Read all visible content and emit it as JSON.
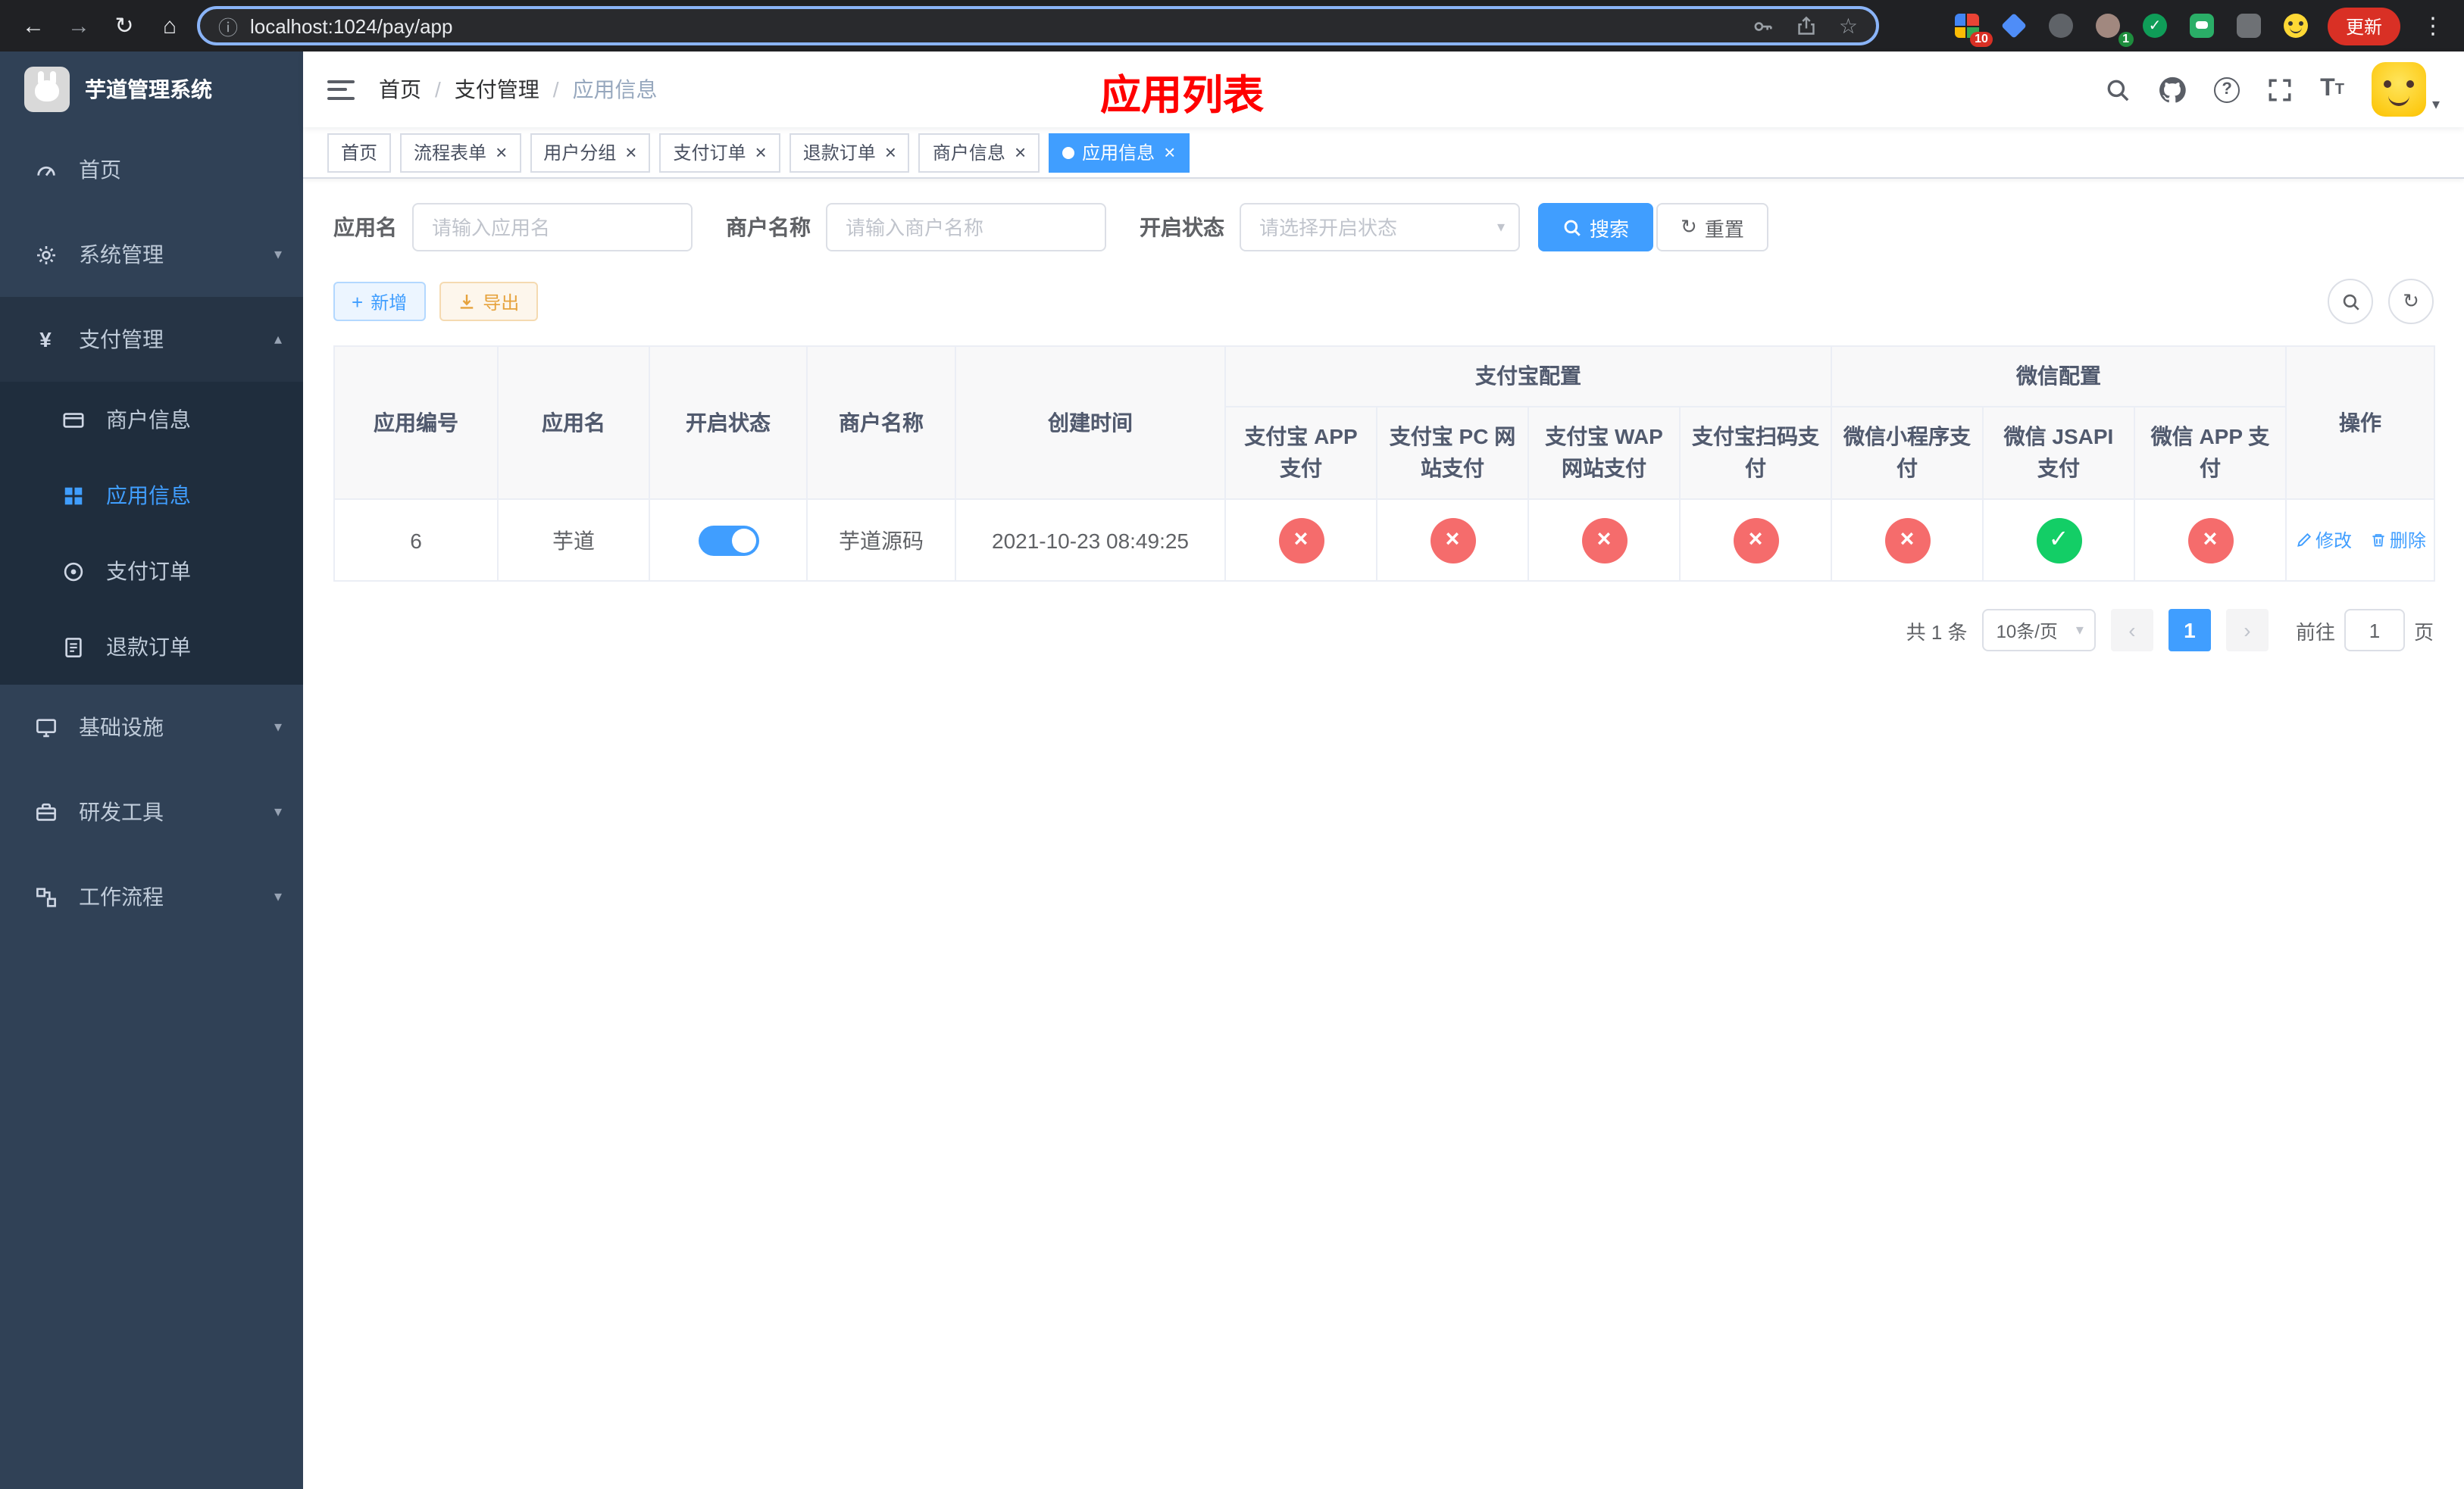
{
  "browser": {
    "url": "localhost:1024/pay/app",
    "update_button": "更新",
    "extensions_badge": "10",
    "profile_badge": "1"
  },
  "sidebar": {
    "app_title": "芋道管理系统",
    "menu": [
      {
        "label": "首页"
      },
      {
        "label": "系统管理"
      },
      {
        "label": "支付管理"
      },
      {
        "label": "商户信息"
      },
      {
        "label": "应用信息"
      },
      {
        "label": "支付订单"
      },
      {
        "label": "退款订单"
      },
      {
        "label": "基础设施"
      },
      {
        "label": "研发工具"
      },
      {
        "label": "工作流程"
      }
    ]
  },
  "navbar": {
    "breadcrumb": [
      "首页",
      "支付管理",
      "应用信息"
    ],
    "page_title": "应用列表"
  },
  "tags": [
    {
      "label": "首页",
      "closable": false,
      "active": false
    },
    {
      "label": "流程表单",
      "closable": true,
      "active": false
    },
    {
      "label": "用户分组",
      "closable": true,
      "active": false
    },
    {
      "label": "支付订单",
      "closable": true,
      "active": false
    },
    {
      "label": "退款订单",
      "closable": true,
      "active": false
    },
    {
      "label": "商户信息",
      "closable": true,
      "active": false
    },
    {
      "label": "应用信息",
      "closable": true,
      "active": true
    }
  ],
  "filters": {
    "app_name_label": "应用名",
    "app_name_placeholder": "请输入应用名",
    "merchant_label": "商户名称",
    "merchant_placeholder": "请输入商户名称",
    "status_label": "开启状态",
    "status_placeholder": "请选择开启状态",
    "search_button": "搜索",
    "reset_button": "重置"
  },
  "toolbar": {
    "add_button": "新增",
    "export_button": "导出"
  },
  "table": {
    "headers": {
      "app_id": "应用编号",
      "app_name": "应用名",
      "status": "开启状态",
      "merchant": "商户名称",
      "created": "创建时间",
      "alipay_group": "支付宝配置",
      "wechat_group": "微信配置",
      "alipay_app": "支付宝 APP 支付",
      "alipay_pc": "支付宝 PC 网站支付",
      "alipay_wap": "支付宝 WAP 网站支付",
      "alipay_qr": "支付宝扫码支付",
      "wechat_mini": "微信小程序支付",
      "wechat_jsapi": "微信 JSAPI 支付",
      "wechat_app": "微信 APP 支付",
      "ops": "操作"
    },
    "rows": [
      {
        "app_id": "6",
        "app_name": "芋道",
        "status_on": true,
        "merchant": "芋道源码",
        "created": "2021-10-23 08:49:25",
        "alipay_app": false,
        "alipay_pc": false,
        "alipay_wap": false,
        "alipay_qr": false,
        "wechat_mini": false,
        "wechat_jsapi": true,
        "wechat_app": false,
        "edit_label": "修改",
        "delete_label": "删除"
      }
    ]
  },
  "pagination": {
    "total": "共 1 条",
    "page_size": "10条/页",
    "current_page": "1",
    "goto_label": "前往",
    "goto_value": "1",
    "page_suffix": "页"
  },
  "colors": {
    "accent": "#409eff",
    "success": "#13ce66",
    "danger": "#f56c6c",
    "title_red": "#ff0000",
    "sidebar_bg": "#304156",
    "submenu_bg": "#1f2d3d"
  }
}
